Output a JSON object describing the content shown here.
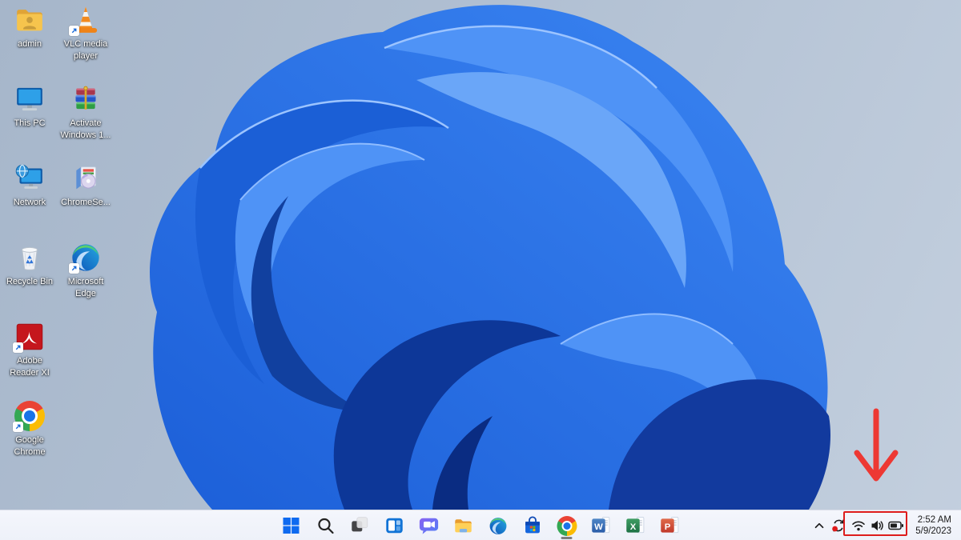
{
  "desktop": {
    "icons": [
      {
        "label": "admin",
        "icon": "user-folder-icon",
        "shortcut": false
      },
      {
        "label": "VLC media player",
        "icon": "vlc-cone-icon",
        "shortcut": true
      },
      {
        "label": "This PC",
        "icon": "this-pc-icon",
        "shortcut": false
      },
      {
        "label": "Activate Windows 1...",
        "icon": "winrar-archive-icon",
        "shortcut": false
      },
      {
        "label": "Network",
        "icon": "network-icon",
        "shortcut": false
      },
      {
        "label": "ChromeSe...",
        "icon": "installer-box-icon",
        "shortcut": false
      },
      {
        "label": "Recycle Bin",
        "icon": "recycle-bin-icon",
        "shortcut": false
      },
      {
        "label": "Microsoft Edge",
        "icon": "edge-icon",
        "shortcut": true
      },
      {
        "label": "Adobe Reader XI",
        "icon": "adobe-reader-icon",
        "shortcut": true
      },
      {
        "label": "Google Chrome",
        "icon": "chrome-icon",
        "shortcut": true
      }
    ]
  },
  "taskbar": {
    "background_color": "#f2f4fb",
    "buttons": [
      {
        "name": "start"
      },
      {
        "name": "search"
      },
      {
        "name": "task-view"
      },
      {
        "name": "widgets"
      },
      {
        "name": "chat"
      },
      {
        "name": "file-explorer"
      },
      {
        "name": "edge"
      },
      {
        "name": "microsoft-store"
      },
      {
        "name": "chrome",
        "running": true
      },
      {
        "name": "word",
        "letter": "W"
      },
      {
        "name": "excel",
        "letter": "X"
      },
      {
        "name": "powerpoint",
        "letter": "P"
      }
    ]
  },
  "system_tray": {
    "icons": [
      {
        "name": "hidden-icons-chevron"
      },
      {
        "name": "sync-update",
        "badge": true,
        "badge_color": "#e01b1b"
      },
      {
        "name": "wifi"
      },
      {
        "name": "volume"
      },
      {
        "name": "battery"
      }
    ],
    "clock": {
      "time": "2:52 AM",
      "date": "5/9/2023"
    }
  },
  "annotation": {
    "highlight_color": "#dd1c1c",
    "arrow_color": "#ed3833"
  }
}
